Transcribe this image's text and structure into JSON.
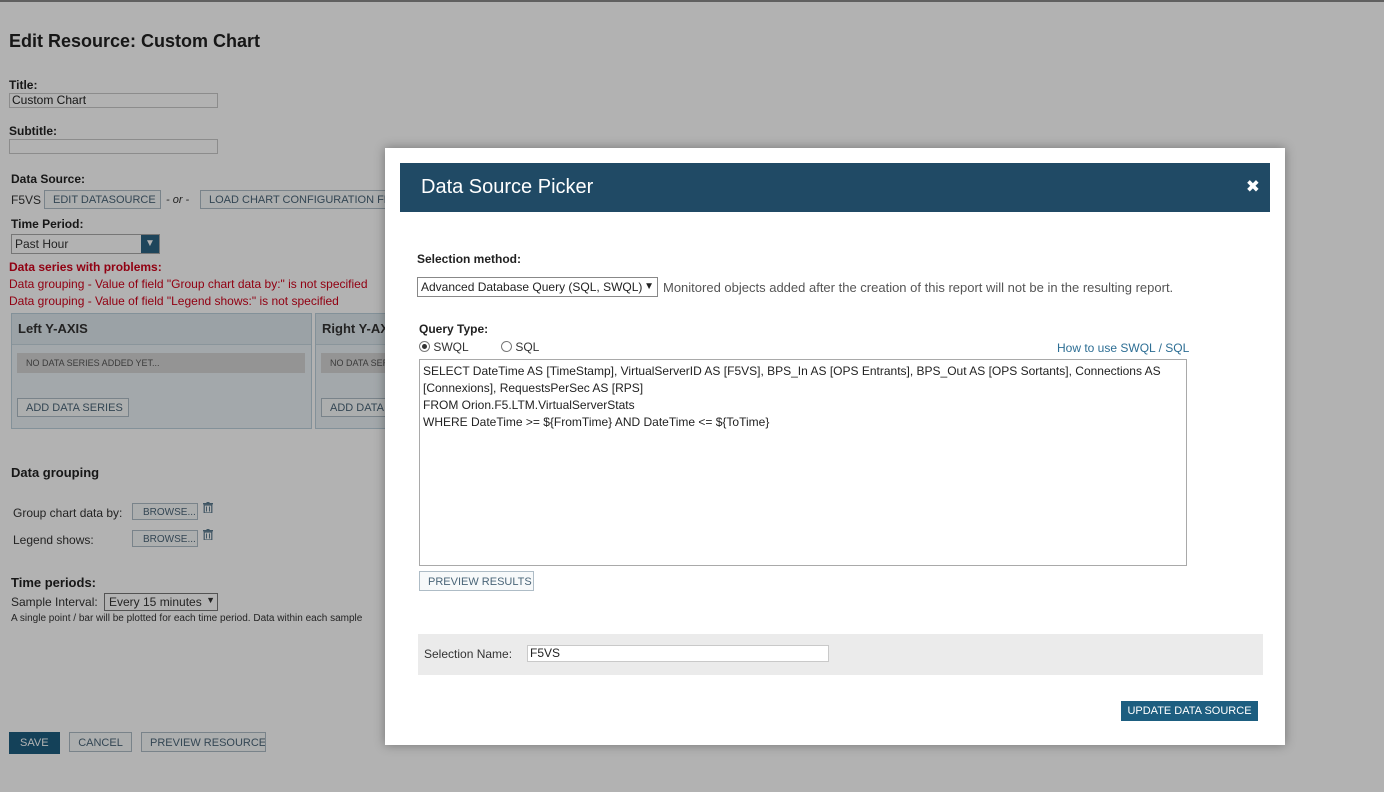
{
  "page": {
    "title": "Edit Resource: Custom Chart",
    "title_label": "Title:",
    "title_value": "Custom Chart",
    "subtitle_label": "Subtitle:",
    "subtitle_value": "",
    "datasource_label": "Data Source:",
    "datasource_name": "F5VS",
    "edit_datasource": "EDIT DATASOURCE",
    "or_text": "- or -",
    "load_config": "LOAD CHART CONFIGURATION FROM",
    "time_period_label": "Time Period:",
    "time_period_value": "Past Hour",
    "problems_heading": "Data series with problems:",
    "problem_1": "Data grouping - Value of field \"Group chart data by:\" is not specified",
    "problem_2": "Data grouping - Value of field \"Legend shows:\" is not specified",
    "left_axis": "Left Y-AXIS",
    "right_axis": "Right Y-AXIS",
    "no_series": "NO DATA SERIES ADDED YET...",
    "add_series": "ADD DATA SERIES",
    "data_grouping_heading": "Data grouping",
    "group_by_label": "Group chart data by:",
    "legend_label": "Legend shows:",
    "browse": "BROWSE...",
    "time_periods_heading": "Time periods:",
    "sample_interval_label": "Sample Interval:",
    "sample_interval_value": "Every 15 minutes",
    "sample_note": "A single point / bar will be plotted for each time period. Data within each sample",
    "save": "SAVE",
    "cancel": "CANCEL",
    "preview_resource": "PREVIEW RESOURCE"
  },
  "modal": {
    "title": "Data Source Picker",
    "close_glyph": "✖",
    "selection_method_label": "Selection method:",
    "selection_method_value": "Advanced Database Query (SQL, SWQL)",
    "selection_note": "Monitored objects added after the creation of this report will not be in the resulting report.",
    "query_type_label": "Query Type:",
    "radio_swql": "SWQL",
    "radio_sql": "SQL",
    "help_link": "How to use SWQL / SQL",
    "query_lines": [
      "SELECT DateTime AS [TimeStamp], VirtualServerID AS [F5VS], BPS_In AS [OPS Entrants], BPS_Out AS [OPS Sortants], Connections AS [Connexions], RequestsPerSec AS [RPS]",
      "FROM Orion.F5.LTM.VirtualServerStats",
      "WHERE DateTime >= ${FromTime} AND DateTime <= ${ToTime}"
    ],
    "preview_results": "PREVIEW RESULTS",
    "selection_name_label": "Selection Name:",
    "selection_name_value": "F5VS",
    "update_button": "UPDATE DATA SOURCE"
  },
  "colors": {
    "accent": "#1d5e80",
    "header": "#204a65",
    "error": "#d0021b",
    "link": "#2d6e94"
  }
}
